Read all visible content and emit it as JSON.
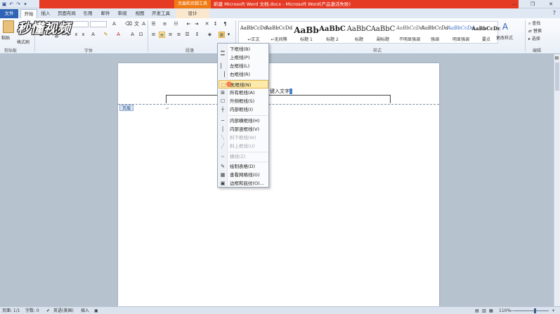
{
  "titlebar": {
    "contextual_tools": "页眉和页脚工具",
    "document_title": "新建 Microsoft Word 文档.docx - Microsoft Word(产品激活失败)",
    "qat_icons": [
      "save-icon",
      "undo-icon",
      "redo-icon",
      "customize-icon"
    ],
    "window_buttons": [
      "—",
      "❐",
      "✕"
    ]
  },
  "tabs": {
    "file": "文件",
    "home": "开始",
    "insert": "插入",
    "layout": "页面布局",
    "references": "引用",
    "mailings": "邮件",
    "review": "审阅",
    "view": "视图",
    "developer": "开发工具",
    "design": "设计"
  },
  "ribbon": {
    "clipboard": {
      "paste": "粘贴",
      "format_painter": "格式刷",
      "group": "剪贴板"
    },
    "font": {
      "group": "字体",
      "size_label": "A"
    },
    "paragraph": {
      "group": "段落"
    },
    "styles": {
      "group": "样式",
      "items": [
        {
          "sample": "AaBbCcDd",
          "name": "↵正文"
        },
        {
          "sample": "AaBbCcDd",
          "name": "↵无间隔"
        },
        {
          "sample": "AaBb",
          "name": "标题 1"
        },
        {
          "sample": "AaBbC",
          "name": "标题 2"
        },
        {
          "sample": "AaBbC",
          "name": "标题"
        },
        {
          "sample": "AaBbC",
          "name": "副标题"
        },
        {
          "sample": "AaBbCcDd",
          "name": "不明显强调"
        },
        {
          "sample": "AaBbCcDd",
          "name": "强调"
        },
        {
          "sample": "AaBbCcDd",
          "name": "明显强调"
        },
        {
          "sample": "AaBbCcDc",
          "name": "要点"
        }
      ],
      "change_styles": "更改样式"
    },
    "editing": {
      "group": "编辑",
      "find": "查找",
      "replace": "替换",
      "select": "选择"
    }
  },
  "watermark": "秒懂视频",
  "document": {
    "header_text": "键入文字",
    "header_badge": "页眉"
  },
  "border_menu": {
    "items": [
      {
        "label": "下框线(B)",
        "icon": "border-bottom-icon",
        "enabled": true
      },
      {
        "label": "上框线(P)",
        "icon": "border-top-icon",
        "enabled": true
      },
      {
        "label": "左框线(L)",
        "icon": "border-left-icon",
        "enabled": true
      },
      {
        "label": "右框线(R)",
        "icon": "border-right-icon",
        "enabled": true
      },
      {
        "label": "无框线(N)",
        "icon": "border-none-icon",
        "enabled": true,
        "hover": true
      },
      {
        "label": "所有框线(A)",
        "icon": "border-all-icon",
        "enabled": true
      },
      {
        "label": "外侧框线(S)",
        "icon": "border-outside-icon",
        "enabled": true
      },
      {
        "label": "内部框线(I)",
        "icon": "border-inside-icon",
        "enabled": true
      },
      {
        "label": "内部横框线(H)",
        "icon": "border-inside-horizontal-icon",
        "enabled": true
      },
      {
        "label": "内部竖框线(V)",
        "icon": "border-inside-vertical-icon",
        "enabled": true
      },
      {
        "label": "斜下框线(W)",
        "icon": "diagonal-down-icon",
        "enabled": false
      },
      {
        "label": "斜上框线(U)",
        "icon": "diagonal-up-icon",
        "enabled": false
      },
      {
        "label": "横线(Z)",
        "icon": "horizontal-line-icon",
        "enabled": false
      },
      {
        "label": "绘制表格(D)",
        "icon": "draw-table-icon",
        "enabled": true
      },
      {
        "label": "查看网格线(G)",
        "icon": "gridlines-icon",
        "enabled": true
      },
      {
        "label": "边框和底纹(O)...",
        "icon": "borders-shading-icon",
        "enabled": true
      }
    ]
  },
  "statusbar": {
    "page": "页面: 1/1",
    "words": "字数: 0",
    "language": "英语(美国)",
    "mode": "插入",
    "zoom": "110%"
  }
}
